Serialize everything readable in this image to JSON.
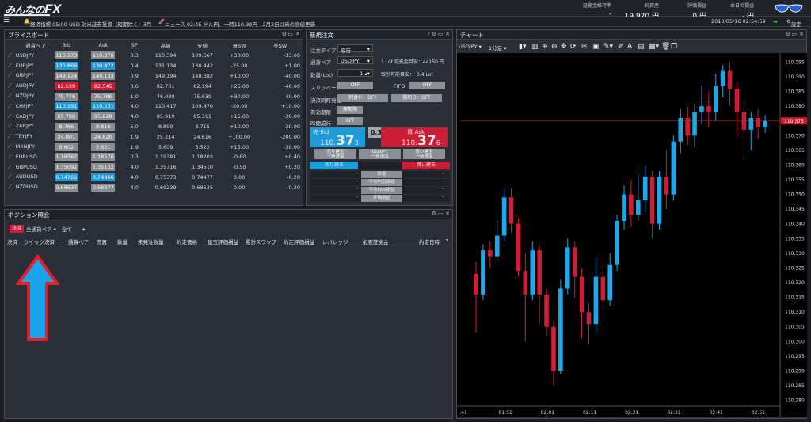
{
  "header": {
    "logo_text": "みんなの",
    "logo_fx": "FX",
    "stats": [
      {
        "label": "証拠金維持率",
        "value": "-"
      },
      {
        "label": "純資産",
        "value": "19,920 円"
      },
      {
        "label": "評価損益",
        "value": "0 円"
      },
      {
        "label": "本日の損益",
        "value": "- 円"
      }
    ]
  },
  "infobar": {
    "alert": "経済指標 05:00 USD 対米証券投資（短期除く）3月",
    "news": "ニュース 02:45 ドル円、一時110.39円　2月2日以来の高値更新",
    "datetime": "2018/05/16 02:54:59",
    "settings": "設定"
  },
  "price_board": {
    "title": "プライスボード",
    "columns": [
      "通貨ペア",
      "Bid",
      "Ask",
      "SP",
      "高値",
      "安値",
      "買SW",
      "売SW"
    ],
    "rows": [
      {
        "pair": "USDJPY",
        "bid": "110.373",
        "ask": "110.376",
        "bid_style": "n",
        "ask_style": "n",
        "sp": "0.3",
        "high": "110.394",
        "low": "109.667",
        "buy_sw": "+30.00",
        "sell_sw": "-33.00",
        "buy_neg": false,
        "sell_neg": true
      },
      {
        "pair": "EURJPY",
        "bid": "130.868",
        "ask": "130.872",
        "bid_style": "b",
        "ask_style": "b",
        "sp": "0.4",
        "high": "131.134",
        "low": "130.442",
        "buy_sw": "-25.00",
        "sell_sw": "+1.00",
        "buy_neg": true,
        "sell_neg": false
      },
      {
        "pair": "GBPJPY",
        "bid": "149.124",
        "ask": "149.133",
        "bid_style": "n",
        "ask_style": "n",
        "sp": "0.9",
        "high": "149.194",
        "low": "148.382",
        "buy_sw": "+10.00",
        "sell_sw": "-40.00",
        "buy_neg": false,
        "sell_neg": true
      },
      {
        "pair": "AUDJPY",
        "bid": "82.539",
        "ask": "82.545",
        "bid_style": "r",
        "ask_style": "r",
        "sp": "0.6",
        "high": "82.701",
        "low": "82.194",
        "buy_sw": "+25.00",
        "sell_sw": "-40.00",
        "buy_neg": false,
        "sell_neg": true
      },
      {
        "pair": "NZDJPY",
        "bid": "75.776",
        "ask": "75.786",
        "bid_style": "n",
        "ask_style": "n",
        "sp": "1.0",
        "high": "76.080",
        "low": "75.639",
        "buy_sw": "+30.00",
        "sell_sw": "-40.00",
        "buy_neg": false,
        "sell_neg": true
      },
      {
        "pair": "CHFJPY",
        "bid": "110.191",
        "ask": "110.231",
        "bid_style": "b",
        "ask_style": "b",
        "sp": "4.0",
        "high": "110.417",
        "low": "109.470",
        "buy_sw": "-20.00",
        "sell_sw": "+10.00",
        "buy_neg": true,
        "sell_neg": false
      },
      {
        "pair": "CADJPY",
        "bid": "85.788",
        "ask": "85.828",
        "bid_style": "n",
        "ask_style": "n",
        "sp": "4.0",
        "high": "85.919",
        "low": "85.311",
        "buy_sw": "+15.00",
        "sell_sw": "-30.00",
        "buy_neg": false,
        "sell_neg": true
      },
      {
        "pair": "ZARJPY",
        "bid": "8.766",
        "ask": "8.816",
        "bid_style": "n",
        "ask_style": "n",
        "sp": "5.0",
        "high": "8.899",
        "low": "8.715",
        "buy_sw": "+10.00",
        "sell_sw": "-20.00",
        "buy_neg": false,
        "sell_neg": true
      },
      {
        "pair": "TRYJPY",
        "bid": "24.801",
        "ask": "24.820",
        "bid_style": "n",
        "ask_style": "n",
        "sp": "1.9",
        "high": "25.214",
        "low": "24.616",
        "buy_sw": "+100.00",
        "sell_sw": "-200.00",
        "buy_neg": false,
        "sell_neg": true
      },
      {
        "pair": "MXNJPY",
        "bid": "5.602",
        "ask": "5.621",
        "bid_style": "n",
        "ask_style": "n",
        "sp": "1.9",
        "high": "5.609",
        "low": "5.522",
        "buy_sw": "+15.00",
        "sell_sw": "-30.00",
        "buy_neg": false,
        "sell_neg": true
      },
      {
        "pair": "EURUSD",
        "bid": "1.18567",
        "ask": "1.18570",
        "bid_style": "n",
        "ask_style": "n",
        "sp": "0.3",
        "high": "1.19381",
        "low": "1.18203",
        "buy_sw": "-0.60",
        "sell_sw": "+0.40",
        "buy_neg": true,
        "sell_neg": false
      },
      {
        "pair": "GBPUSD",
        "bid": "1.35092",
        "ask": "1.35132",
        "bid_style": "n",
        "ask_style": "n",
        "sp": "4.0",
        "high": "1.35716",
        "low": "1.34510",
        "buy_sw": "-0.50",
        "sell_sw": "+0.20",
        "buy_neg": true,
        "sell_neg": false
      },
      {
        "pair": "AUDUSD",
        "bid": "0.74766",
        "ask": "0.74806",
        "bid_style": "b",
        "ask_style": "b",
        "sp": "4.0",
        "high": "0.75373",
        "low": "0.74477",
        "buy_sw": "0.00",
        "sell_sw": "-0.20",
        "buy_neg": false,
        "sell_neg": true
      },
      {
        "pair": "NZDUSD",
        "bid": "0.68637",
        "ask": "0.68677",
        "bid_style": "n",
        "ask_style": "n",
        "sp": "4.0",
        "high": "0.69239",
        "low": "0.68535",
        "buy_sw": "0.00",
        "sell_sw": "-0.20",
        "buy_neg": false,
        "sell_neg": true
      }
    ]
  },
  "new_order": {
    "title": "新規注文",
    "order_type_label": "注文タイプ",
    "order_type": "成行",
    "pair_label": "通貨ペア",
    "pair": "USDJPY",
    "margin_text": "1 Lot 証拠金目安：44150 円",
    "qty_label": "数量(Lot)",
    "qty": "1",
    "tradable_text": "取引可能目安：　0.4 Lot",
    "slippage_label": "スリッページ",
    "slippage": "OFF",
    "fifo_label": "FIFO",
    "fifo": "OFF",
    "settle_label": "決済同時発注",
    "settle_limit": "利食い：OFF",
    "settle_stop": "損切り：OFF",
    "expiry_label": "有効期限",
    "expiry": "無期限",
    "timed_label": "時間成行",
    "timed": "OFF",
    "bid_label": "売 Bid",
    "bid_price": {
      "pre": "110.",
      "big": "37",
      "post": "3"
    },
    "spread": "0.3",
    "ask_label": "買 Ask",
    "ask_price": {
      "pre": "110.",
      "big": "37",
      "post": "6"
    },
    "sell_settle": "売り建玉\n一括決済",
    "mid_pair": "USDJPY\n一括決済",
    "buy_settle": "買い建玉\n一括決済",
    "sell_pos": "売り建玉",
    "buy_pos": "買い建玉",
    "summary": [
      "数量",
      "平均約定価格",
      "平均Pips損益",
      "評価損益"
    ],
    "dash": "-"
  },
  "positions": {
    "title": "ポジション照会",
    "settle_tag": "決済",
    "filter_pair": "全通貨ペア",
    "filter_all": "全て",
    "columns": [
      "決済",
      "クイック決済",
      "通貨ペア",
      "売買",
      "数量",
      "未発注数量",
      "約定価格",
      "建玉評価損益",
      "累計スワップ",
      "約定評価損益",
      "レバレッジ",
      "必要証拠金",
      "約定日時"
    ]
  },
  "chart": {
    "title": "チャート",
    "pair": "USDJPY",
    "interval": "1分足",
    "current_price": "110.375",
    "chart_data": {
      "type": "candlestick",
      "y_ticks": [
        "110.395",
        "110.390",
        "110.385",
        "110.380",
        "110.375",
        "110.370",
        "110.365",
        "110.360",
        "110.355",
        "110.350",
        "110.345",
        "110.340",
        "110.335",
        "110.330",
        "110.325",
        "110.320",
        "110.315",
        "110.310",
        "110.305",
        "110.300",
        "110.295",
        "110.290",
        "110.285",
        "110.280"
      ],
      "x_ticks": [
        ":41",
        "01:51",
        "02:01",
        "02:11",
        "02:21",
        "02:31",
        "02:41",
        "02:51"
      ],
      "ylim": [
        110.278,
        110.397
      ],
      "candles": [
        {
          "o": 110.323,
          "c": 110.316,
          "h": 110.327,
          "l": 110.303
        },
        {
          "o": 110.316,
          "c": 110.331,
          "h": 110.333,
          "l": 110.314
        },
        {
          "o": 110.331,
          "c": 110.329,
          "h": 110.334,
          "l": 110.325
        },
        {
          "o": 110.329,
          "c": 110.336,
          "h": 110.341,
          "l": 110.327
        },
        {
          "o": 110.336,
          "c": 110.349,
          "h": 110.352,
          "l": 110.334
        },
        {
          "o": 110.349,
          "c": 110.34,
          "h": 110.352,
          "l": 110.337
        },
        {
          "o": 110.34,
          "c": 110.324,
          "h": 110.342,
          "l": 110.322
        },
        {
          "o": 110.324,
          "c": 110.316,
          "h": 110.33,
          "l": 110.3
        },
        {
          "o": 110.316,
          "c": 110.331,
          "h": 110.334,
          "l": 110.314
        },
        {
          "o": 110.331,
          "c": 110.316,
          "h": 110.333,
          "l": 110.306
        },
        {
          "o": 110.316,
          "c": 110.305,
          "h": 110.318,
          "l": 110.302
        },
        {
          "o": 110.305,
          "c": 110.29,
          "h": 110.307,
          "l": 110.285
        },
        {
          "o": 110.29,
          "c": 110.318,
          "h": 110.321,
          "l": 110.289
        },
        {
          "o": 110.318,
          "c": 110.332,
          "h": 110.335,
          "l": 110.316
        },
        {
          "o": 110.332,
          "c": 110.322,
          "h": 110.334,
          "l": 110.315
        },
        {
          "o": 110.322,
          "c": 110.31,
          "h": 110.325,
          "l": 110.301
        },
        {
          "o": 110.31,
          "c": 110.306,
          "h": 110.313,
          "l": 110.299
        },
        {
          "o": 110.306,
          "c": 110.322,
          "h": 110.329,
          "l": 110.303
        },
        {
          "o": 110.322,
          "c": 110.314,
          "h": 110.326,
          "l": 110.311
        },
        {
          "o": 110.314,
          "c": 110.326,
          "h": 110.33,
          "l": 110.312
        },
        {
          "o": 110.326,
          "c": 110.341,
          "h": 110.343,
          "l": 110.324
        },
        {
          "o": 110.341,
          "c": 110.35,
          "h": 110.353,
          "l": 110.338
        },
        {
          "o": 110.35,
          "c": 110.343,
          "h": 110.355,
          "l": 110.339
        },
        {
          "o": 110.343,
          "c": 110.348,
          "h": 110.357,
          "l": 110.341
        },
        {
          "o": 110.348,
          "c": 110.356,
          "h": 110.36,
          "l": 110.344
        },
        {
          "o": 110.356,
          "c": 110.34,
          "h": 110.358,
          "l": 110.335
        },
        {
          "o": 110.34,
          "c": 110.356,
          "h": 110.358,
          "l": 110.338
        },
        {
          "o": 110.356,
          "c": 110.35,
          "h": 110.365,
          "l": 110.345
        },
        {
          "o": 110.35,
          "c": 110.368,
          "h": 110.37,
          "l": 110.348
        },
        {
          "o": 110.368,
          "c": 110.376,
          "h": 110.379,
          "l": 110.364
        },
        {
          "o": 110.376,
          "c": 110.37,
          "h": 110.38,
          "l": 110.367
        },
        {
          "o": 110.37,
          "c": 110.378,
          "h": 110.381,
          "l": 110.366
        },
        {
          "o": 110.378,
          "c": 110.38,
          "h": 110.387,
          "l": 110.374
        },
        {
          "o": 110.38,
          "c": 110.378,
          "h": 110.385,
          "l": 110.373
        },
        {
          "o": 110.378,
          "c": 110.387,
          "h": 110.391,
          "l": 110.375
        },
        {
          "o": 110.387,
          "c": 110.392,
          "h": 110.394,
          "l": 110.383
        },
        {
          "o": 110.392,
          "c": 110.386,
          "h": 110.395,
          "l": 110.38
        },
        {
          "o": 110.386,
          "c": 110.378,
          "h": 110.388,
          "l": 110.37
        },
        {
          "o": 110.378,
          "c": 110.372,
          "h": 110.38,
          "l": 110.362
        },
        {
          "o": 110.372,
          "c": 110.376,
          "h": 110.378,
          "l": 110.365
        },
        {
          "o": 110.376,
          "c": 110.373,
          "h": 110.379,
          "l": 110.369
        },
        {
          "o": 110.373,
          "c": 110.375,
          "h": 110.377,
          "l": 110.371
        }
      ]
    }
  }
}
